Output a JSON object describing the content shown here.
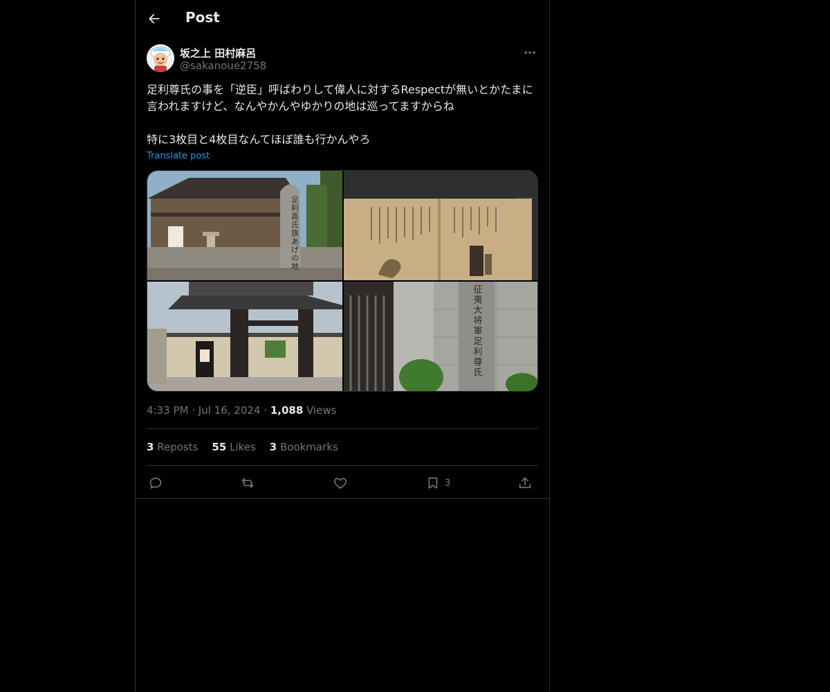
{
  "header": {
    "title": "Post",
    "back_icon": "arrow-left-icon"
  },
  "author": {
    "display_name": "坂之上 田村麻呂",
    "handle": "@sakanoue2758",
    "more_icon": "more-horizontal-icon"
  },
  "post": {
    "text": "足利尊氏の事を「逆臣」呼ばわりして偉人に対するRespectが無いとかたまに言われますけど、なんやかんやゆかりの地は巡ってますからね\n\n特に3枚目と4枚目なんてほぼ誰も行かんやろ",
    "translate_label": "Translate post",
    "images": [
      {
        "name": "photo-stone-monument",
        "stone_text": "足利高氏旗あげの地"
      },
      {
        "name": "photo-document-scroll"
      },
      {
        "name": "photo-temple-gate"
      },
      {
        "name": "photo-stone-pillar",
        "stone_text": "征夷大将軍足利尊氏"
      }
    ]
  },
  "meta": {
    "time": "4:33 PM",
    "separator": "·",
    "date": "Jul 16, 2024",
    "views_count": "1,088",
    "views_label": "Views"
  },
  "stats": {
    "reposts_count": "3",
    "reposts_label": "Reposts",
    "likes_count": "55",
    "likes_label": "Likes",
    "bookmarks_count": "3",
    "bookmarks_label": "Bookmarks"
  },
  "actions": {
    "reply_icon": "reply-icon",
    "repost_icon": "repost-icon",
    "like_icon": "heart-icon",
    "bookmark_icon": "bookmark-icon",
    "bookmark_count": "3",
    "share_icon": "share-icon"
  },
  "colors": {
    "background": "#000000",
    "text": "#e7e9ea",
    "muted": "#71767b",
    "accent": "#1d9bf0",
    "border": "#2f3336"
  }
}
